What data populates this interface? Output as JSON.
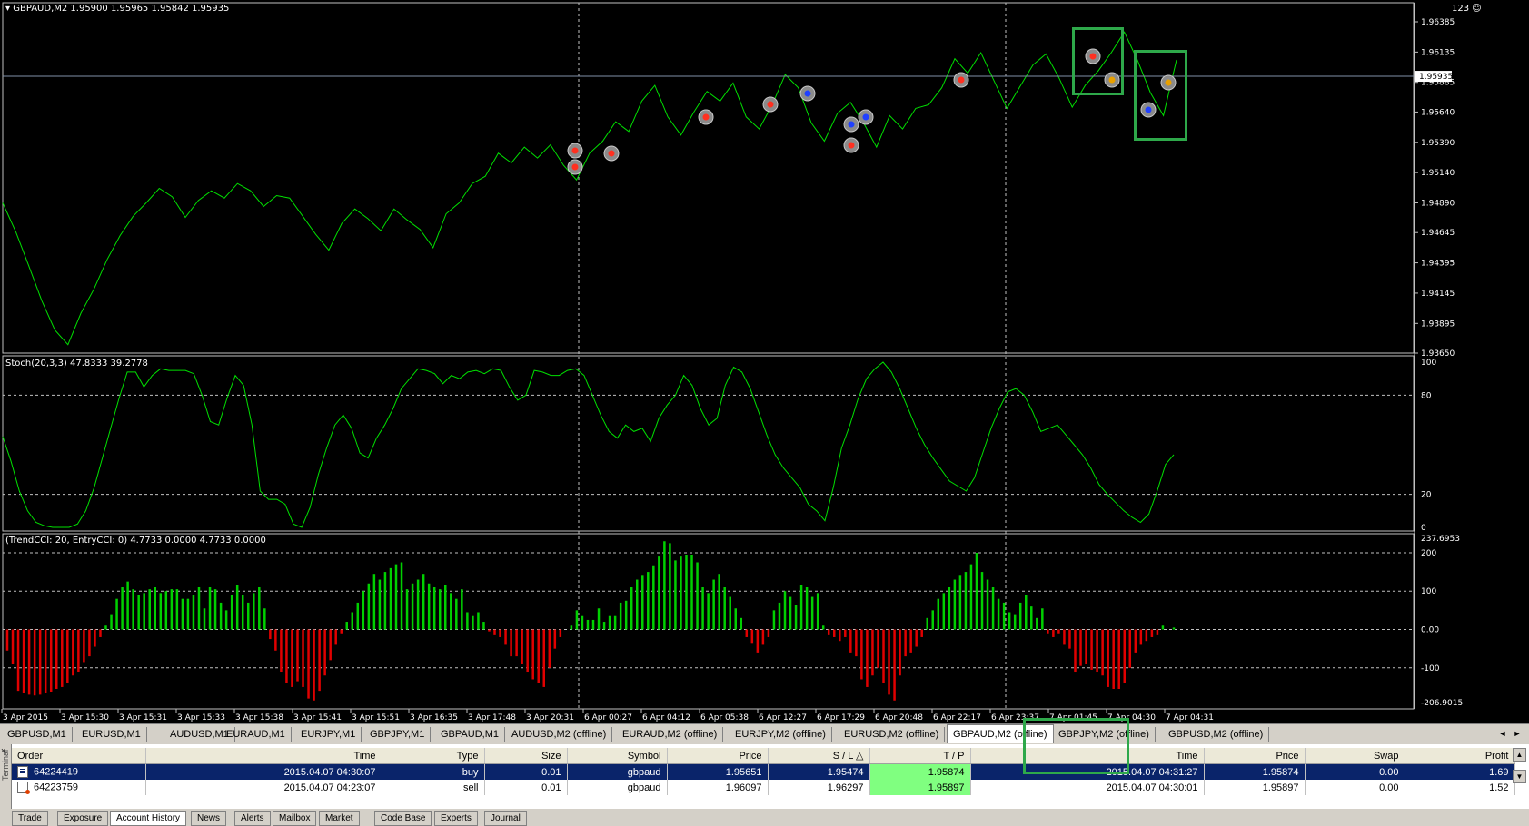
{
  "main_chart": {
    "header": "GBPAUD,M2  1.95900 1.95965 1.95842 1.95935",
    "top_right": "123 ☺",
    "current_price": "1.95935",
    "price_ticks": [
      "1.96385",
      "1.96135",
      "1.95885",
      "1.95640",
      "1.95390",
      "1.95140",
      "1.94890",
      "1.94645",
      "1.94395",
      "1.94145",
      "1.93895",
      "1.93650"
    ],
    "price_range": [
      1.9365,
      1.96385
    ],
    "line_color": "#00e000",
    "series": [
      1.9489,
      1.9465,
      1.9437,
      1.9408,
      1.9384,
      1.9372,
      1.9398,
      1.9418,
      1.9442,
      1.9462,
      1.9478,
      1.9489,
      1.9501,
      1.9494,
      1.9477,
      1.9491,
      1.9499,
      1.9493,
      1.9505,
      1.9499,
      1.9486,
      1.9495,
      1.9493,
      1.9478,
      1.9463,
      1.945,
      1.9472,
      1.9484,
      1.9476,
      1.9466,
      1.9484,
      1.9475,
      1.9467,
      1.9452,
      1.948,
      1.9489,
      1.9505,
      1.9511,
      1.953,
      1.9522,
      1.9535,
      1.9526,
      1.9537,
      1.952,
      1.9508,
      1.953,
      1.954,
      1.9556,
      1.9548,
      1.9573,
      1.9586,
      1.956,
      1.9545,
      1.9564,
      1.9581,
      1.9573,
      1.9588,
      1.956,
      1.955,
      1.957,
      1.9595,
      1.9584,
      1.9555,
      1.954,
      1.9563,
      1.9572,
      1.9555,
      1.9535,
      1.9561,
      1.955,
      1.9567,
      1.957,
      1.9584,
      1.9608,
      1.9596,
      1.9613,
      1.959,
      1.9567,
      1.9585,
      1.9603,
      1.9612,
      1.9592,
      1.9568,
      1.9586,
      1.9598,
      1.9613,
      1.963,
      1.9607,
      1.958,
      1.9561,
      1.9607
    ]
  },
  "stoch": {
    "label": "Stoch(20,3,3) 47.8333 39.2778",
    "ticks": [
      "100",
      "80",
      "20",
      "0"
    ],
    "range": [
      0,
      100
    ],
    "series": [
      55,
      40,
      22,
      10,
      3,
      1,
      0,
      0,
      0,
      2,
      10,
      24,
      42,
      60,
      78,
      94,
      94,
      85,
      92,
      96,
      95,
      95,
      95,
      93,
      80,
      64,
      62,
      78,
      92,
      86,
      62,
      22,
      17,
      17,
      14,
      2,
      0,
      12,
      32,
      48,
      62,
      68,
      60,
      45,
      42,
      54,
      62,
      72,
      84,
      90,
      96,
      95,
      93,
      87,
      92,
      90,
      94,
      95,
      93,
      96,
      95,
      85,
      77,
      80,
      95,
      94,
      92,
      92,
      95,
      96,
      92,
      80,
      68,
      58,
      54,
      62,
      58,
      60,
      52,
      66,
      74,
      80,
      92,
      86,
      72,
      62,
      66,
      86,
      97,
      94,
      84,
      70,
      56,
      44,
      36,
      30,
      24,
      14,
      10,
      4,
      24,
      48,
      62,
      78,
      90,
      96,
      100,
      94,
      84,
      72,
      60,
      50,
      42,
      35,
      28,
      25,
      22,
      30,
      45,
      60,
      72,
      82,
      84,
      80,
      70,
      58,
      60,
      62,
      56,
      50,
      44,
      36,
      26,
      20,
      15,
      10,
      6,
      3,
      8,
      22,
      38,
      44
    ]
  },
  "cci": {
    "label": "(TrendCCI: 20, EntryCCI: 0)  4.7733 0.0000 4.7733 0.0000",
    "max_label": "237.6953",
    "min_label": "-206.9015",
    "ticks": [
      "200",
      "100",
      "0.00",
      "-100"
    ],
    "range": [
      -206.9015,
      237.6953
    ],
    "values": [
      -55,
      -90,
      -160,
      -165,
      -170,
      -172,
      -170,
      -165,
      -162,
      -155,
      -150,
      -140,
      -120,
      -110,
      -85,
      -70,
      -45,
      -20,
      10,
      40,
      80,
      110,
      125,
      105,
      90,
      95,
      105,
      110,
      95,
      100,
      105,
      105,
      80,
      80,
      90,
      110,
      55,
      110,
      105,
      70,
      50,
      90,
      115,
      90,
      70,
      95,
      110,
      55,
      -25,
      -55,
      -110,
      -140,
      -150,
      -135,
      -150,
      -180,
      -185,
      -160,
      -120,
      -80,
      -40,
      -10,
      20,
      45,
      70,
      100,
      120,
      145,
      130,
      150,
      160,
      170,
      175,
      105,
      120,
      130,
      145,
      120,
      110,
      105,
      115,
      95,
      80,
      105,
      45,
      35,
      45,
      20,
      -5,
      -15,
      -20,
      -40,
      -70,
      -70,
      -90,
      -110,
      -130,
      -140,
      -150,
      -100,
      -50,
      -20,
      0,
      10,
      50,
      35,
      25,
      25,
      55,
      20,
      35,
      35,
      70,
      75,
      110,
      130,
      140,
      150,
      165,
      190,
      230,
      225,
      180,
      190,
      195,
      195,
      175,
      110,
      95,
      130,
      145,
      110,
      85,
      55,
      30,
      -20,
      -35,
      -60,
      -40,
      -20,
      50,
      70,
      100,
      85,
      65,
      115,
      110,
      85,
      95,
      10,
      -15,
      -20,
      -30,
      -20,
      -60,
      -70,
      -130,
      -150,
      -120,
      -100,
      -140,
      -170,
      -185,
      -120,
      -70,
      -60,
      -45,
      -20,
      30,
      50,
      80,
      95,
      110,
      130,
      140,
      150,
      170,
      200,
      150,
      130,
      110,
      80,
      70,
      45,
      40,
      70,
      90,
      60,
      30,
      55,
      -10,
      -20,
      -10,
      -40,
      -50,
      -110,
      -95,
      -90,
      -105,
      -110,
      -120,
      -150,
      -155,
      -155,
      -140,
      -100,
      -60,
      -40,
      -30,
      -20,
      -15,
      10,
      0,
      5
    ],
    "pos_color": "#00d000",
    "neg_color": "#e00000"
  },
  "time_axis": [
    "3 Apr 2015",
    "3 Apr 15:30",
    "3 Apr 15:31",
    "3 Apr 15:33",
    "3 Apr 15:38",
    "3 Apr 15:41",
    "3 Apr 15:51",
    "3 Apr 16:35",
    "3 Apr 17:48",
    "3 Apr 20:31",
    "6 Apr 00:27",
    "6 Apr 04:12",
    "6 Apr 05:38",
    "6 Apr 12:27",
    "6 Apr 17:29",
    "6 Apr 20:48",
    "6 Apr 22:17",
    "6 Apr 23:37",
    "7 Apr 01:45",
    "7 Apr 04:30",
    "7 Apr 04:31"
  ],
  "symbol_tabs": [
    "GBPUSD,M1",
    "EURUSD,M1",
    "AUDUSD,M1",
    "EURAUD,M1",
    "EURJPY,M1",
    "GBPJPY,M1",
    "GBPAUD,M1",
    "AUDUSD,M2 (offline)",
    "EURAUD,M2 (offline)",
    "EURJPY,M2 (offline)",
    "EURUSD,M2 (offline)",
    "GBPAUD,M2 (offline)",
    "GBPJPY,M2 (offline)",
    "GBPUSD,M2 (offline)"
  ],
  "active_tab": "GBPAUD,M2 (offline)",
  "terminal": {
    "side_label": "Terminal",
    "close_glyph": "×",
    "columns": [
      "Order",
      "Time",
      "Type",
      "Size",
      "Symbol",
      "Price",
      "S / L",
      "T / P",
      "Time",
      "Price",
      "Swap",
      "Profit"
    ],
    "sort_glyph": "△",
    "rows": [
      {
        "order": "64224419",
        "open_time": "2015.04.07 04:30:07",
        "type": "buy",
        "size": "0.01",
        "symbol": "gbpaud",
        "price": "1.95651",
        "sl": "1.95474",
        "tp": "1.95874",
        "close_time": "2015.04.07 04:31:27",
        "close_price": "1.95874",
        "swap": "0.00",
        "profit": "1.69"
      },
      {
        "order": "64223759",
        "open_time": "2015.04.07 04:23:07",
        "type": "sell",
        "size": "0.01",
        "symbol": "gbpaud",
        "price": "1.96097",
        "sl": "1.96297",
        "tp": "1.95897",
        "close_time": "2015.04.07 04:30:01",
        "close_price": "1.95897",
        "swap": "0.00",
        "profit": "1.52"
      }
    ],
    "bottom_tabs": [
      "Trade",
      "Exposure",
      "Account History",
      "News",
      "Alerts",
      "Mailbox",
      "Market",
      "Code Base",
      "Experts",
      "Journal"
    ],
    "active_bottom_tab": "Account History"
  }
}
